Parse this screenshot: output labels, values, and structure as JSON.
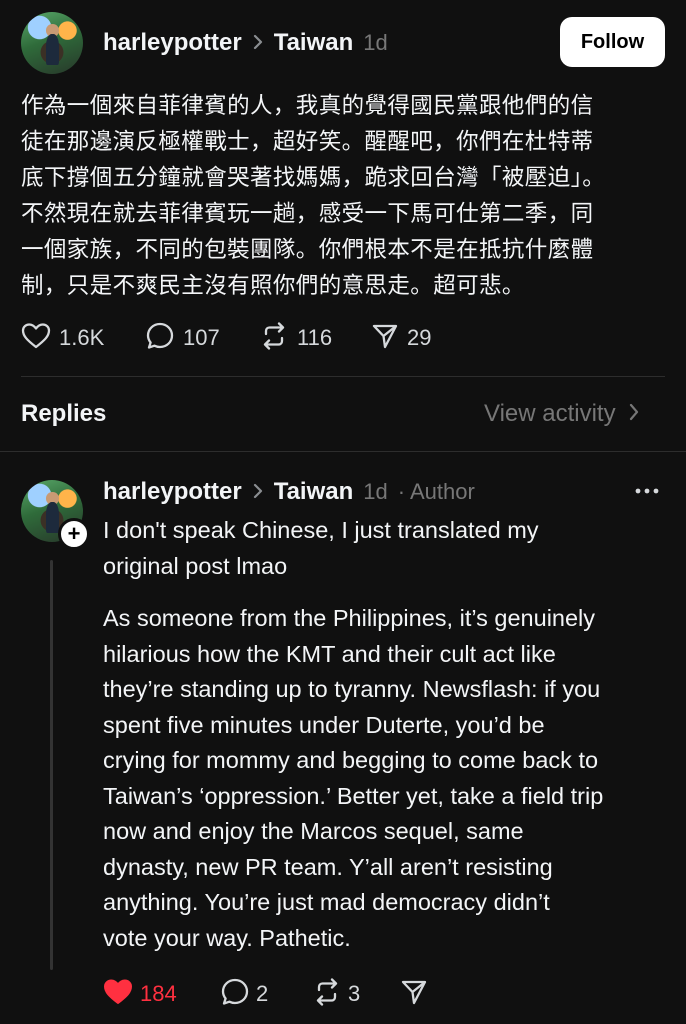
{
  "post": {
    "username": "harleypotter",
    "topic": "Taiwan",
    "time": "1d",
    "follow_label": "Follow",
    "lines": [
      "作為一個來自菲律賓的人，我真的覺得國民黨跟他們的信",
      "徒在那邊演反極權戰士，超好笑。醒醒吧，你們在杜特蒂",
      "底下撐個五分鐘就會哭著找媽媽，跪求回台灣「被壓迫」。",
      "不然現在就去菲律賓玩一趟，感受一下馬可仕第二季，同",
      "一個家族，不同的包裝團隊。你們根本不是在抵抗什麼體",
      "制，只是不爽民主沒有照你們的意思走。超可悲。"
    ],
    "likes": "1.6K",
    "comments": "107",
    "reposts": "116",
    "shares": "29"
  },
  "replies_section": {
    "label": "Replies",
    "view_activity": "View activity"
  },
  "reply": {
    "username": "harleypotter",
    "topic": "Taiwan",
    "time": "1d",
    "badge": "· Author",
    "more": "•••",
    "lines": [
      "I don't speak Chinese, I just translated my",
      "original post lmao",
      "",
      "As someone from the Philippines, it’s genuinely",
      "hilarious how the KMT and their cult act like",
      "they’re standing up to tyranny. Newsflash: if you",
      "spent five minutes under Duterte, you’d be",
      "crying for mommy and begging to come back to",
      "Taiwan’s ‘oppression.’ Better yet, take a field trip",
      "now and enjoy the Marcos sequel, same",
      "dynasty, new PR team. Y’all aren’t resisting",
      "anything. You’re just mad democracy didn’t",
      "vote your way. Pathetic."
    ],
    "likes": "184",
    "comments": "2",
    "reposts": "3",
    "like_color": "#ff3040"
  },
  "icons": {
    "heart": "heart-icon",
    "comment": "comment-icon",
    "repost": "repost-icon",
    "share": "share-icon",
    "chevron": "chevron-right-icon",
    "more": "more-icon",
    "plus": "plus-icon"
  }
}
